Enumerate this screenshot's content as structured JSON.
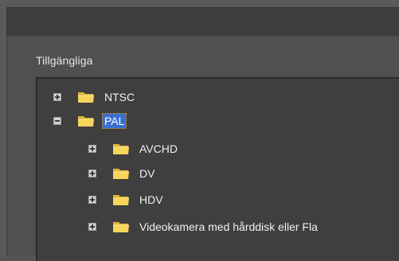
{
  "dialog": {
    "section_label": "Tillgängliga"
  },
  "tree": {
    "items": [
      {
        "label": "NTSC",
        "expanded": false,
        "selected": false,
        "level": 0
      },
      {
        "label": "PAL",
        "expanded": true,
        "selected": true,
        "level": 0
      },
      {
        "label": "AVCHD",
        "expanded": false,
        "selected": false,
        "level": 1
      },
      {
        "label": "DV",
        "expanded": false,
        "selected": false,
        "level": 1
      },
      {
        "label": "HDV",
        "expanded": false,
        "selected": false,
        "level": 1
      },
      {
        "label": "Videokamera med hårddisk eller Fla",
        "expanded": false,
        "selected": false,
        "level": 1
      }
    ]
  },
  "colors": {
    "folder_fill": "#f3cd4a",
    "selection": "#3a6fd1",
    "tree_background": "#3f3f3f"
  },
  "icons": {
    "expand": "plus-box-icon",
    "collapse": "minus-box-icon",
    "folder": "folder-icon"
  }
}
